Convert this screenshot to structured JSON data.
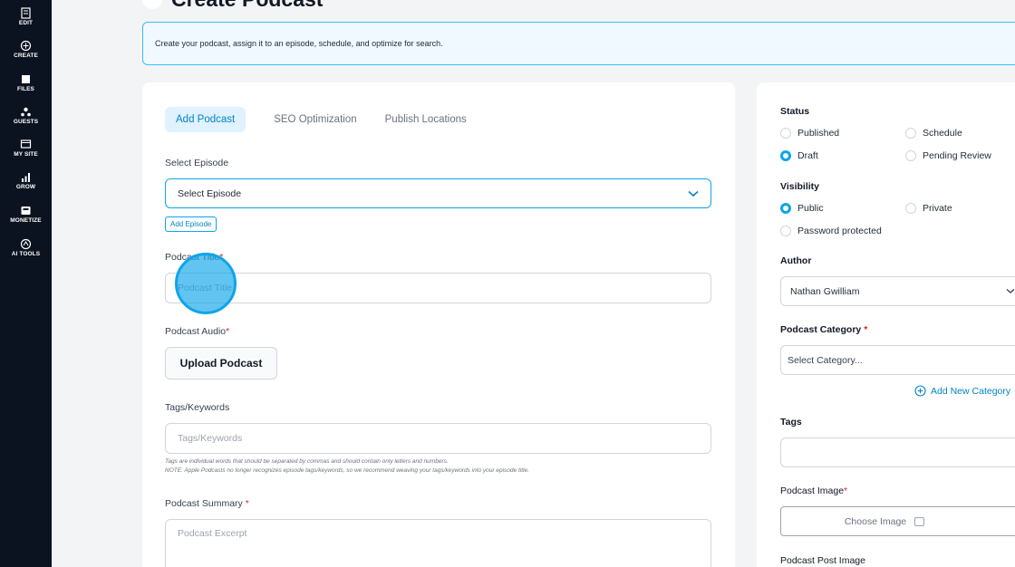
{
  "sidebar": {
    "items": [
      {
        "label": "EDIT",
        "icon": "edit-icon"
      },
      {
        "label": "CREATE",
        "icon": "create-icon"
      },
      {
        "label": "FILES",
        "icon": "files-icon"
      },
      {
        "label": "GUESTS",
        "icon": "guests-icon"
      },
      {
        "label": "MY SITE",
        "icon": "site-icon"
      },
      {
        "label": "GROW",
        "icon": "grow-icon"
      },
      {
        "label": "MONETIZE",
        "icon": "monetize-icon"
      },
      {
        "label": "AI TOOLS",
        "icon": "ai-tools-icon"
      }
    ]
  },
  "page": {
    "title": "Create Podcast",
    "banner": "Create your podcast, assign it to an episode, schedule, and optimize for search."
  },
  "tabs": [
    "Add Podcast",
    "SEO Optimization",
    "Publish Locations"
  ],
  "form": {
    "episode_label": "Select Episode",
    "episode_value": "Select Episode",
    "add_episode": "Add Episode",
    "title_label": "Podcast Title",
    "title_placeholder": "Podcast Title",
    "audio_label": "Podcast Audio",
    "upload_label": "Upload Podcast",
    "tags_label": "Tags/Keywords",
    "tags_placeholder": "Tags/Keywords",
    "tags_help_1": "Tags are individual words that should be separated by commas and should contain only letters and numbers.",
    "tags_help_2": "NOTE: Apple Podcasts no longer recognizes episode tags/keywords, so we recommend weaving your tags/keywords into your episode title.",
    "summary_label": "Podcast Summary",
    "summary_placeholder": "Podcast Excerpt",
    "required_mark": "*"
  },
  "publish": {
    "status_label": "Status",
    "status_options": [
      "Published",
      "Schedule",
      "Draft",
      "Pending Review"
    ],
    "status_selected": "Draft",
    "visibility_label": "Visibility",
    "visibility_options": [
      "Public",
      "Private",
      "Password protected"
    ],
    "visibility_selected": "Public",
    "author_label": "Author",
    "author_value": "Nathan Gwilliam",
    "category_label": "Podcast Category",
    "category_placeholder": "Select Category...",
    "add_category": "Add New Category",
    "tags_label": "Tags",
    "image_label": "Podcast Image",
    "choose_image": "Choose Image",
    "post_image_label": "Podcast Post Image"
  },
  "colors": {
    "accent": "#0ea5e9",
    "sidebar_bg": "#0b1220",
    "required": "#dc2626"
  }
}
